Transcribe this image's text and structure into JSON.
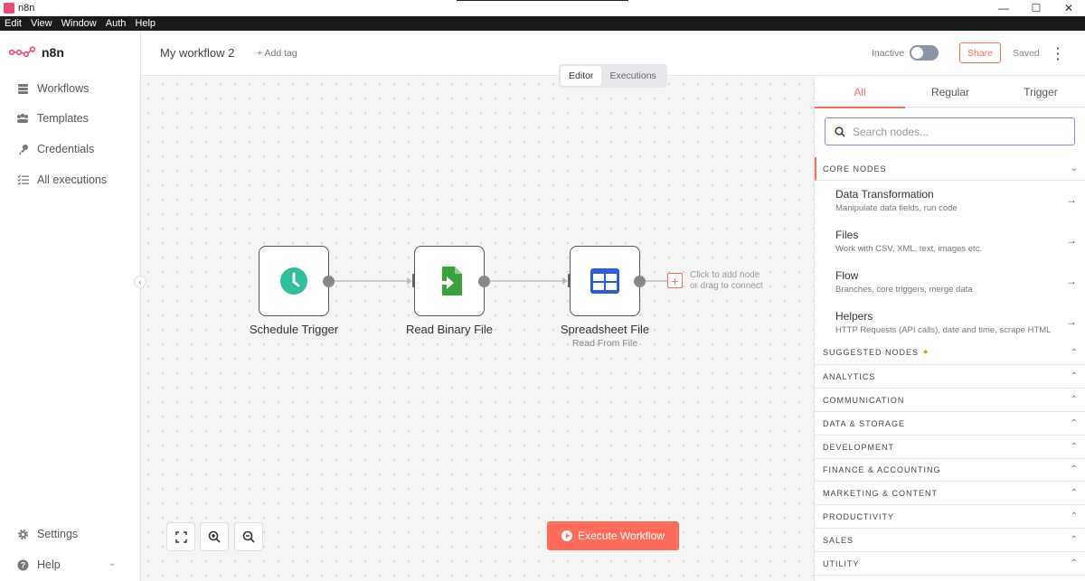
{
  "window": {
    "title": "n8n",
    "controls": [
      "—",
      "☐",
      "✕"
    ]
  },
  "menu": [
    "Edit",
    "View",
    "Window",
    "Auth",
    "Help"
  ],
  "sidebar": {
    "logo_text": "n8n",
    "items": [
      {
        "label": "Workflows",
        "icon": "workflows-icon"
      },
      {
        "label": "Templates",
        "icon": "templates-icon"
      },
      {
        "label": "Credentials",
        "icon": "key-icon"
      },
      {
        "label": "All executions",
        "icon": "list-icon"
      }
    ],
    "bottom": [
      {
        "label": "Settings",
        "icon": "gear-icon"
      },
      {
        "label": "Help",
        "icon": "help-icon"
      }
    ]
  },
  "header": {
    "workflow_name": "My workflow 2",
    "add_tag": "+ Add tag",
    "status_label": "Inactive",
    "share": "Share",
    "saved": "Saved"
  },
  "mode_switch": {
    "tabs": [
      "Editor",
      "Executions"
    ],
    "active": "Editor"
  },
  "nodes": [
    {
      "label": "Schedule Trigger",
      "sub": "",
      "icon": "clock-icon"
    },
    {
      "label": "Read Binary File",
      "sub": "",
      "icon": "file-import-icon"
    },
    {
      "label": "Spreadsheet File",
      "sub": "Read From File",
      "icon": "table-icon"
    }
  ],
  "add_hint": {
    "line1": "Click to add node",
    "line2": "or drag to connect"
  },
  "execute_button": "Execute Workflow",
  "panel": {
    "tabs": [
      "All",
      "Regular",
      "Trigger"
    ],
    "active_tab": "All",
    "search_placeholder": "Search nodes...",
    "core_section": "CORE NODES",
    "core_items": [
      {
        "title": "Data Transformation",
        "desc": "Manipulate data fields, run code"
      },
      {
        "title": "Files",
        "desc": "Work with CSV, XML, text, images etc."
      },
      {
        "title": "Flow",
        "desc": "Branches, core triggers, merge data"
      },
      {
        "title": "Helpers",
        "desc": "HTTP Requests (API calls), date and time, scrape HTML"
      }
    ],
    "sections": [
      "SUGGESTED NODES",
      "ANALYTICS",
      "COMMUNICATION",
      "DATA & STORAGE",
      "DEVELOPMENT",
      "FINANCE & ACCOUNTING",
      "MARKETING & CONTENT",
      "PRODUCTIVITY",
      "SALES",
      "UTILITY"
    ]
  },
  "colors": {
    "accent": "#ff6d5a",
    "clock": "#2fbf9c",
    "file": "#3aa23a",
    "table": "#2c5bdc"
  }
}
